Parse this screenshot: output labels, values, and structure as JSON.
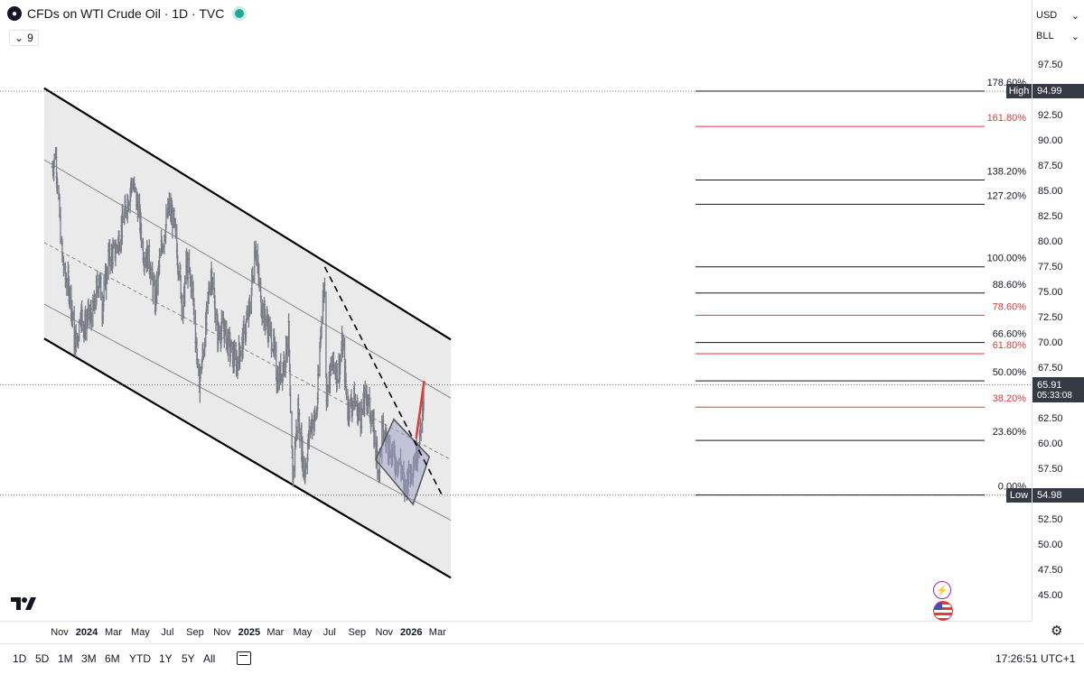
{
  "header": {
    "title": "CFDs on WTI Crude Oil · 1D · TVC",
    "indicator_count": "9"
  },
  "price_axis": {
    "currency": "USD",
    "unit": "BLL",
    "ticks": [
      "97.50",
      "92.50",
      "90.00",
      "87.50",
      "85.00",
      "82.50",
      "80.00",
      "77.50",
      "75.00",
      "72.50",
      "70.00",
      "67.50",
      "62.50",
      "60.00",
      "57.50",
      "52.50",
      "50.00",
      "47.50",
      "45.00"
    ],
    "high_label": "High",
    "high_value": "94.99",
    "low_label": "Low",
    "low_value": "54.98",
    "last_price": "65.91",
    "countdown": "05:33:08"
  },
  "time_axis": {
    "labels": [
      "Nov",
      "2024",
      "Mar",
      "May",
      "Jul",
      "Sep",
      "Nov",
      "2025",
      "Mar",
      "May",
      "Jul",
      "Sep",
      "Nov",
      "2026",
      "Mar"
    ]
  },
  "bottom_bar": {
    "ranges": [
      "1D",
      "5D",
      "1M",
      "3M",
      "6M",
      "YTD",
      "1Y",
      "5Y",
      "All"
    ],
    "clock": "17:26:51 UTC+1"
  },
  "colors": {
    "bar": "#787b86",
    "channel_fill": "#e6e6e6",
    "fib_red": "#e53935",
    "highlight_box": "#9b9bc5",
    "price_tag": "#363a45"
  },
  "chart_data": {
    "type": "ohlc",
    "symbol": "CFDs on WTI Crude Oil",
    "interval": "1D",
    "ylim": [
      44,
      100
    ],
    "x_range": [
      "2023-10-09",
      "2026-03-31"
    ],
    "high": 94.99,
    "low": 54.98,
    "last": 65.91,
    "close_trace": [
      [
        "2023-10-16",
        87.5
      ],
      [
        "2023-10-23",
        89.0
      ],
      [
        "2023-10-30",
        84.0
      ],
      [
        "2023-11-06",
        79.0
      ],
      [
        "2023-11-13",
        76.5
      ],
      [
        "2023-11-20",
        76.0
      ],
      [
        "2023-11-27",
        74.0
      ],
      [
        "2023-12-04",
        70.5
      ],
      [
        "2023-12-11",
        70.0
      ],
      [
        "2023-12-18",
        73.5
      ],
      [
        "2023-12-26",
        71.5
      ],
      [
        "2024-01-02",
        72.5
      ],
      [
        "2024-01-16",
        73.0
      ],
      [
        "2024-01-29",
        77.0
      ],
      [
        "2024-02-05",
        73.5
      ],
      [
        "2024-02-19",
        78.5
      ],
      [
        "2024-03-04",
        79.0
      ],
      [
        "2024-03-18",
        81.0
      ],
      [
        "2024-04-01",
        84.0
      ],
      [
        "2024-04-12",
        86.0
      ],
      [
        "2024-04-26",
        83.5
      ],
      [
        "2024-05-08",
        79.0
      ],
      [
        "2024-05-20",
        78.5
      ],
      [
        "2024-06-03",
        74.0
      ],
      [
        "2024-06-17",
        79.5
      ],
      [
        "2024-07-05",
        83.5
      ],
      [
        "2024-07-15",
        82.0
      ],
      [
        "2024-07-29",
        76.5
      ],
      [
        "2024-08-05",
        73.0
      ],
      [
        "2024-08-12",
        78.0
      ],
      [
        "2024-08-26",
        75.5
      ],
      [
        "2024-09-10",
        66.0
      ],
      [
        "2024-09-23",
        70.5
      ],
      [
        "2024-10-07",
        77.5
      ],
      [
        "2024-10-21",
        71.0
      ],
      [
        "2024-11-04",
        71.5
      ],
      [
        "2024-11-18",
        69.5
      ],
      [
        "2024-12-02",
        68.0
      ],
      [
        "2024-12-16",
        70.0
      ],
      [
        "2025-01-02",
        73.5
      ],
      [
        "2025-01-15",
        80.0
      ],
      [
        "2025-01-27",
        74.0
      ],
      [
        "2025-02-10",
        72.0
      ],
      [
        "2025-02-24",
        70.0
      ],
      [
        "2025-03-05",
        66.5
      ],
      [
        "2025-03-17",
        67.5
      ],
      [
        "2025-03-31",
        71.0
      ],
      [
        "2025-04-04",
        62.0
      ],
      [
        "2025-04-09",
        57.0
      ],
      [
        "2025-04-21",
        63.5
      ],
      [
        "2025-05-05",
        57.0
      ],
      [
        "2025-05-19",
        62.0
      ],
      [
        "2025-06-02",
        63.0
      ],
      [
        "2025-06-13",
        73.0
      ],
      [
        "2025-06-20",
        76.0
      ],
      [
        "2025-06-24",
        65.0
      ],
      [
        "2025-07-07",
        68.0
      ],
      [
        "2025-07-21",
        67.0
      ],
      [
        "2025-07-30",
        70.0
      ],
      [
        "2025-08-11",
        63.5
      ],
      [
        "2025-08-25",
        64.5
      ],
      [
        "2025-09-08",
        62.5
      ],
      [
        "2025-09-22",
        65.0
      ],
      [
        "2025-10-06",
        62.0
      ],
      [
        "2025-10-20",
        57.5
      ],
      [
        "2025-10-27",
        61.5
      ],
      [
        "2025-11-10",
        60.0
      ],
      [
        "2025-11-24",
        58.5
      ],
      [
        "2025-12-08",
        58.0
      ],
      [
        "2025-12-16",
        55.5
      ],
      [
        "2025-12-30",
        57.5
      ],
      [
        "2026-01-12",
        59.0
      ],
      [
        "2026-01-21",
        61.0
      ],
      [
        "2026-01-30",
        65.91
      ]
    ],
    "fibonacci": {
      "levels": [
        {
          "label": "178.60%",
          "price": 95.0,
          "color": "#131722"
        },
        {
          "label": "161.80%",
          "price": 91.5,
          "color": "#e53935"
        },
        {
          "label": "138.20%",
          "price": 86.2,
          "color": "#131722"
        },
        {
          "label": "127.20%",
          "price": 83.8,
          "color": "#131722"
        },
        {
          "label": "100.00%",
          "price": 77.6,
          "color": "#131722"
        },
        {
          "label": "88.60%",
          "price": 75.0,
          "color": "#131722"
        },
        {
          "label": "78.60%",
          "price": 72.8,
          "color": "#e53935"
        },
        {
          "label": "66.60%",
          "price": 70.1,
          "color": "#131722"
        },
        {
          "label": "61.80%",
          "price": 69.0,
          "color": "#e53935"
        },
        {
          "label": "50.00%",
          "price": 66.3,
          "color": "#131722"
        },
        {
          "label": "38.20%",
          "price": 63.7,
          "color": "#e53935"
        },
        {
          "label": "23.60%",
          "price": 60.4,
          "color": "#131722"
        },
        {
          "label": "0.00%",
          "price": 55.0,
          "color": "#131722"
        }
      ]
    },
    "channel": {
      "start_date": "2023-09-27",
      "end_date": "2026-03-31",
      "upper": [
        95.3,
        70.4
      ],
      "upper_mid": [
        88.2,
        64.6
      ],
      "mid": [
        80.0,
        58.5
      ],
      "lower_mid": [
        73.9,
        52.5
      ],
      "lower": [
        70.5,
        46.8
      ]
    },
    "downtrend_line": {
      "from": [
        "2025-06-20",
        77.6
      ],
      "to": [
        "2026-03-10",
        55.1
      ]
    },
    "consolidation_box": {
      "from_date": "2025-10-13",
      "to_date": "2026-01-05",
      "top_left": 62.5,
      "bottom_left": 58.5
    },
    "breakout_arrow": {
      "from": [
        "2026-01-12",
        60.6
      ],
      "to": [
        "2026-01-30",
        66.3
      ]
    },
    "grid": false,
    "legend": "none"
  }
}
